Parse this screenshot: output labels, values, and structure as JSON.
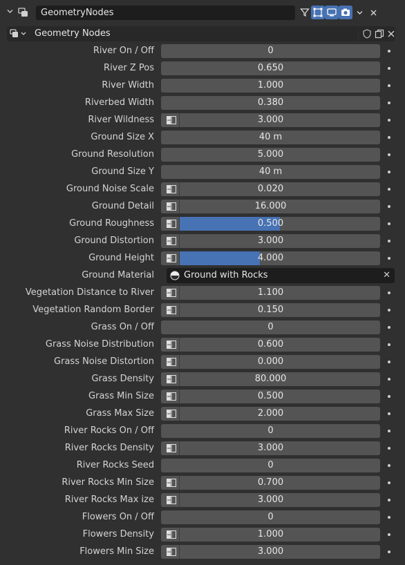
{
  "modifier": {
    "name": "GeometryNodes",
    "icons": [
      "expand-chevron-icon",
      "geometry-nodes-modifier-icon",
      "filter-funnel-icon",
      "edit-mode-icon",
      "realtime-viewport-icon",
      "render-camera-icon",
      "dropdown-chevron-icon",
      "close-icon"
    ]
  },
  "node_group": {
    "name": "Geometry Nodes",
    "icons": [
      "node-tree-browse-icon",
      "fake-user-shield-icon",
      "duplicate-icon",
      "unlink-icon"
    ]
  },
  "colors": {
    "accent": "#4772b3",
    "field": "#545454",
    "background": "#303030"
  },
  "params": [
    {
      "label": "River On / Off",
      "value": "0",
      "icon": false
    },
    {
      "label": "River Z Pos",
      "value": "0.650",
      "icon": false
    },
    {
      "label": "River Width",
      "value": "1.000",
      "icon": false
    },
    {
      "label": "Riverbed Width",
      "value": "0.380",
      "icon": false
    },
    {
      "label": "River Wildness",
      "value": "3.000",
      "icon": true
    },
    {
      "label": "Ground Size X",
      "value": "40 m",
      "icon": false
    },
    {
      "label": "Ground Resolution",
      "value": "5.000",
      "icon": false
    },
    {
      "label": "Ground Size Y",
      "value": "40 m",
      "icon": false
    },
    {
      "label": "Ground Noise Scale",
      "value": "0.020",
      "icon": true
    },
    {
      "label": "Ground Detail",
      "value": "16.000",
      "icon": true
    },
    {
      "label": "Ground Roughness",
      "value": "0.500",
      "icon": true,
      "fill": 0.5
    },
    {
      "label": "Ground Distortion",
      "value": "3.000",
      "icon": true
    },
    {
      "label": "Ground Height",
      "value": "4.000",
      "icon": true,
      "fill": 0.4
    },
    {
      "label": "Ground Material",
      "material": "Ground with Rocks"
    },
    {
      "label": "Vegetation Distance to River",
      "value": "1.100",
      "icon": true
    },
    {
      "label": "Vegetation Random Border",
      "value": "0.150",
      "icon": true
    },
    {
      "label": "Grass On / Off",
      "value": "0",
      "icon": false
    },
    {
      "label": "Grass Noise Distribution",
      "value": "0.600",
      "icon": true
    },
    {
      "label": "Grass Noise Distortion",
      "value": "0.000",
      "icon": true
    },
    {
      "label": "Grass Density",
      "value": "80.000",
      "icon": true
    },
    {
      "label": "Grass Min Size",
      "value": "0.500",
      "icon": true
    },
    {
      "label": "Grass Max Size",
      "value": "2.000",
      "icon": true
    },
    {
      "label": "River Rocks  On / Off",
      "value": "0",
      "icon": false
    },
    {
      "label": "River Rocks Density",
      "value": "3.000",
      "icon": true
    },
    {
      "label": "River Rocks Seed",
      "value": "0",
      "icon": false
    },
    {
      "label": "River Rocks Min Size",
      "value": "0.700",
      "icon": true
    },
    {
      "label": "River Rocks Max ize",
      "value": "3.000",
      "icon": true
    },
    {
      "label": "Flowers On / Off",
      "value": "0",
      "icon": false
    },
    {
      "label": "Flowers Density",
      "value": "1.000",
      "icon": true
    },
    {
      "label": "Flowers Min Size",
      "value": "3.000",
      "icon": true
    }
  ]
}
